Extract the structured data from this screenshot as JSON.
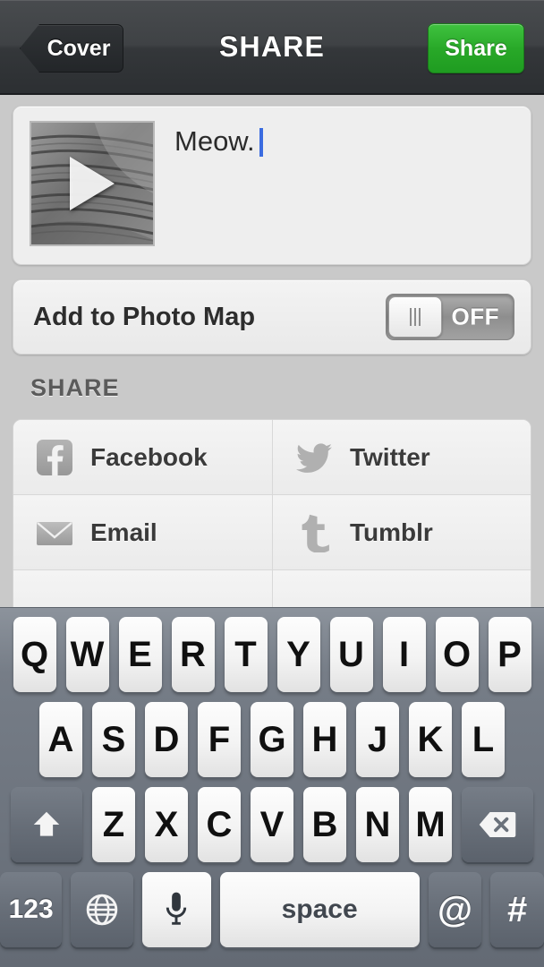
{
  "navbar": {
    "back_label": "Cover",
    "title": "SHARE",
    "share_label": "Share",
    "share_button_color": "#28a828"
  },
  "caption": {
    "text": "Meow.",
    "caret_color": "#3b6ce0",
    "thumbnail_alt": "video-thumbnail-printed-text",
    "play_icon": "play-icon"
  },
  "photo_map": {
    "label": "Add to Photo Map",
    "toggle_state": "OFF"
  },
  "share_section": {
    "header": "SHARE",
    "rows": [
      [
        {
          "icon": "facebook-icon",
          "label": "Facebook"
        },
        {
          "icon": "twitter-icon",
          "label": "Twitter"
        }
      ],
      [
        {
          "icon": "email-icon",
          "label": "Email"
        },
        {
          "icon": "tumblr-icon",
          "label": "Tumblr"
        }
      ],
      [
        {
          "icon": "flickr-icon",
          "label": ""
        },
        {
          "icon": "foursquare-icon",
          "label": ""
        }
      ]
    ]
  },
  "keyboard": {
    "row1": [
      "Q",
      "W",
      "E",
      "R",
      "T",
      "Y",
      "U",
      "I",
      "O",
      "P"
    ],
    "row2": [
      "A",
      "S",
      "D",
      "F",
      "G",
      "H",
      "J",
      "K",
      "L"
    ],
    "row3": [
      "Z",
      "X",
      "C",
      "V",
      "B",
      "N",
      "M"
    ],
    "shift_icon": "shift-icon",
    "backspace_icon": "backspace-icon",
    "numbers_label": "123",
    "globe_icon": "globe-icon",
    "mic_icon": "microphone-icon",
    "space_label": "space",
    "at_label": "@",
    "hash_label": "#"
  }
}
